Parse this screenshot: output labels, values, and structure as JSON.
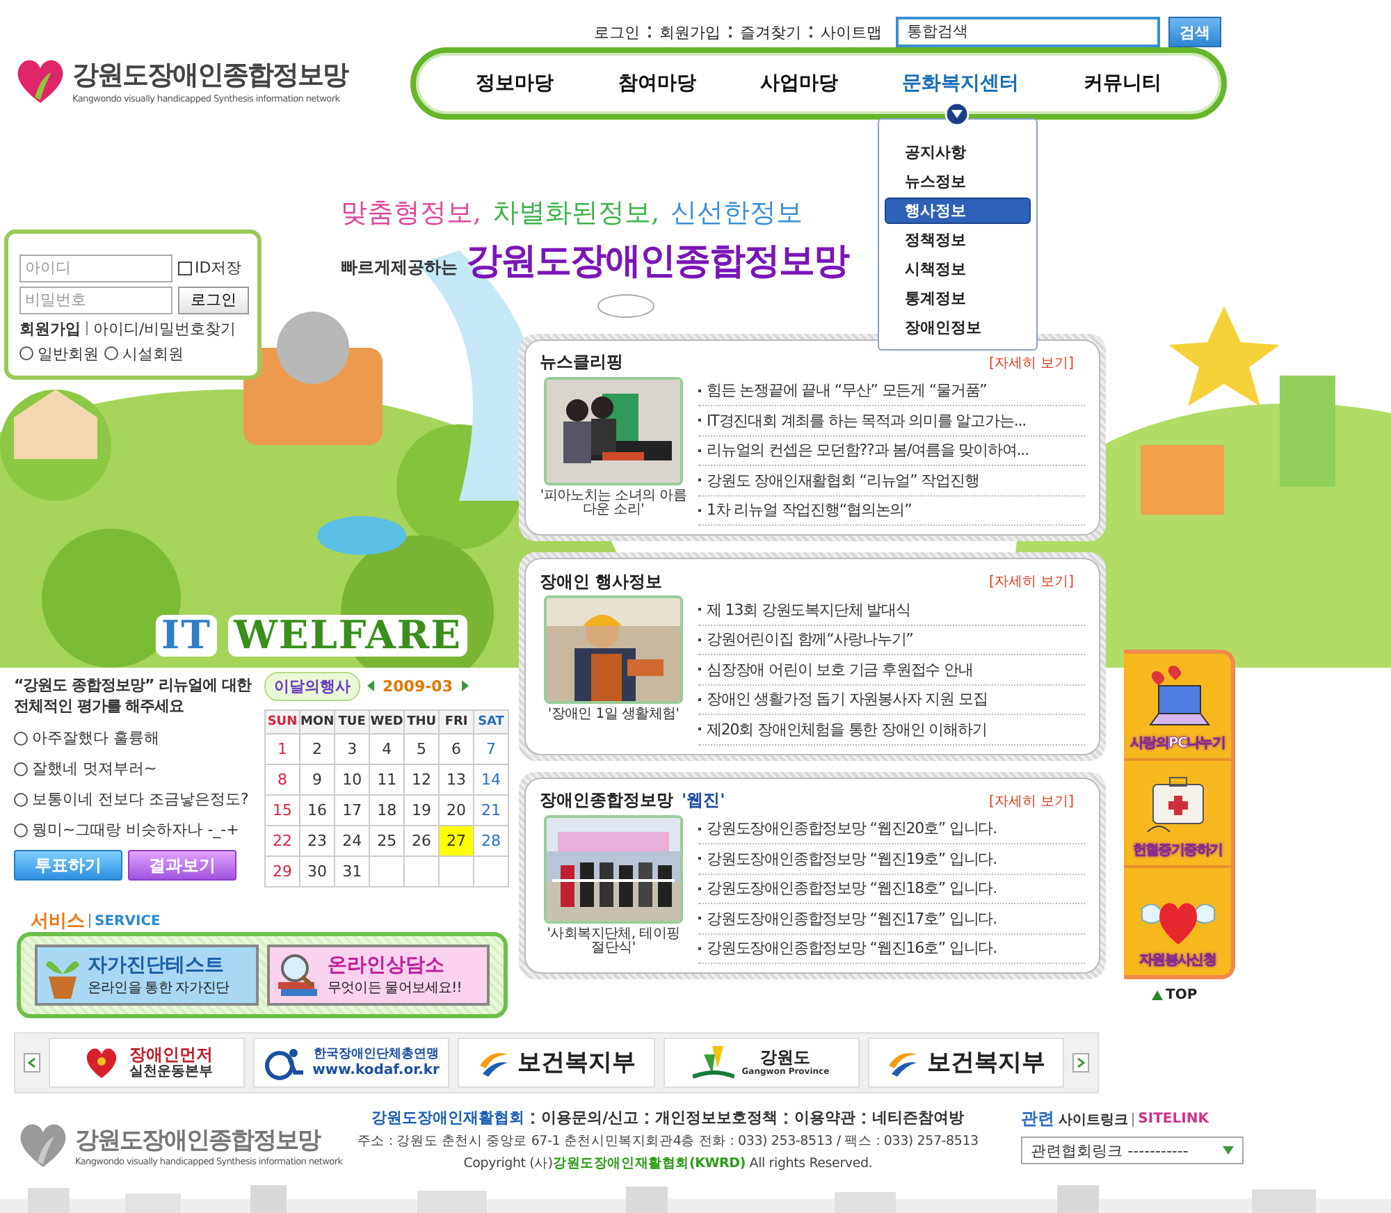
{
  "header": {
    "logo": {
      "title": "강원도장애인종합정보망",
      "subtitle": "Kangwondo visually handicapped Synthesis information network"
    },
    "top_links": [
      "로그인",
      "회원가입",
      "즐겨찾기",
      "사이트맵"
    ],
    "search": {
      "placeholder": "통합검색",
      "button": "검색"
    },
    "nav": [
      {
        "label": "정보마당",
        "selected": false
      },
      {
        "label": "참여마당",
        "selected": false
      },
      {
        "label": "사업마당",
        "selected": false
      },
      {
        "label": "문화복지센터",
        "selected": true,
        "submenu": [
          {
            "label": "공지사항",
            "selected": false
          },
          {
            "label": "뉴스정보",
            "selected": false
          },
          {
            "label": "행사정보",
            "selected": true
          },
          {
            "label": "정책정보",
            "selected": false
          },
          {
            "label": "시책정보",
            "selected": false
          },
          {
            "label": "통계정보",
            "selected": false
          },
          {
            "label": "장애인정보",
            "selected": false
          }
        ]
      },
      {
        "label": "커뮤니티",
        "selected": false
      }
    ]
  },
  "login": {
    "id_placeholder": "아이디",
    "password_placeholder": "비밀번호",
    "remember": {
      "label": "ID저장",
      "checked": false
    },
    "button": "로그인",
    "join": "회원가입",
    "find": "아이디/비밀번호찾기",
    "member_types": [
      {
        "label": "일반회원",
        "selected": false
      },
      {
        "label": "시설회원",
        "selected": false
      }
    ]
  },
  "slogan": {
    "phrases": [
      {
        "text": "맞춤형정보,",
        "color": "#e0469a"
      },
      {
        "text": "차별화된정보,",
        "color": "#3cb34a"
      },
      {
        "text": "신선한정보",
        "color": "#3a8fd6"
      }
    ],
    "lead": "빠르게제공하는",
    "name": "강원도장애인종합정보망"
  },
  "banner_words": [
    {
      "text": "IT",
      "color": "#2f7fc8"
    },
    {
      "text": "WELFARE",
      "color": "#3a8f1c"
    }
  ],
  "poll": {
    "question": "“강원도 종합정보망” 리뉴얼에 대한 전체적인 평가를 해주세요",
    "options": [
      {
        "label": "아주잘했다 훌륭해",
        "selected": false
      },
      {
        "label": "잘했네 멋져부러~",
        "selected": false
      },
      {
        "label": "보통이네 전보다 조금낳은정도?",
        "selected": false
      },
      {
        "label": "뭥미~그때랑 비슷하자나 -_-+",
        "selected": false
      }
    ],
    "vote_button": "투표하기",
    "result_button": "결과보기"
  },
  "calendar": {
    "title": "이달의행사",
    "month": "2009-03",
    "weekdays": [
      "SUN",
      "MON",
      "TUE",
      "WED",
      "THU",
      "FRI",
      "SAT"
    ],
    "weeks": [
      [
        {
          "day": "1",
          "highlighted": false
        },
        {
          "day": "2",
          "highlighted": false
        },
        {
          "day": "3",
          "highlighted": false
        },
        {
          "day": "4",
          "highlighted": false
        },
        {
          "day": "5",
          "highlighted": false
        },
        {
          "day": "6",
          "highlighted": false
        },
        {
          "day": "7",
          "highlighted": false
        }
      ],
      [
        {
          "day": "8",
          "highlighted": false
        },
        {
          "day": "9",
          "highlighted": false
        },
        {
          "day": "10",
          "highlighted": false
        },
        {
          "day": "11",
          "highlighted": false
        },
        {
          "day": "12",
          "highlighted": false
        },
        {
          "day": "13",
          "highlighted": false
        },
        {
          "day": "14",
          "highlighted": false
        }
      ],
      [
        {
          "day": "15",
          "highlighted": false
        },
        {
          "day": "16",
          "highlighted": false
        },
        {
          "day": "17",
          "highlighted": false
        },
        {
          "day": "18",
          "highlighted": false
        },
        {
          "day": "19",
          "highlighted": false
        },
        {
          "day": "20",
          "highlighted": false
        },
        {
          "day": "21",
          "highlighted": false
        }
      ],
      [
        {
          "day": "22",
          "highlighted": false
        },
        {
          "day": "23",
          "highlighted": false
        },
        {
          "day": "24",
          "highlighted": false
        },
        {
          "day": "25",
          "highlighted": false
        },
        {
          "day": "26",
          "highlighted": false
        },
        {
          "day": "27",
          "highlighted": true
        },
        {
          "day": "28",
          "highlighted": false
        }
      ],
      [
        {
          "day": "29",
          "highlighted": false
        },
        {
          "day": "30",
          "highlighted": false
        },
        {
          "day": "31",
          "highlighted": false
        }
      ]
    ]
  },
  "service": {
    "title": "서비스",
    "subtitle": "SERVICE",
    "items": [
      {
        "kind": "test",
        "title": "자가진단테스트",
        "text": "온라인을 통한 자가진단"
      },
      {
        "kind": "counsel",
        "title": "온라인상담소",
        "text": "무엇이든 물어보세요!!"
      }
    ]
  },
  "panels": [
    {
      "title": "뉴스클리핑",
      "more": "[자세히 보기]",
      "caption": "'피아노치는 소녀의 아름다운 소리'",
      "items": [
        "힘든 논쟁끝에 끝내 “무산” 모든게 “물거품”",
        "IT경진대회 계최를 하는 목적과 의미를 알고가는...",
        "리뉴얼의 컨셉은 모던함??과 봄/여름을 맞이하여...",
        "강원도 장애인재활협회 “리뉴얼” 작업진행",
        "1차 리뉴얼 작업진행“협의논의”"
      ]
    },
    {
      "title": "장애인 행사정보",
      "more": "[자세히 보기]",
      "caption": "'장애인 1일 생활체험'",
      "items": [
        "제 13회 강원도복지단체 발대식",
        "강원어린이집 함께“사랑나누기”",
        "심장장애 어린이 보호 기금 후원접수 안내",
        "장애인 생활가정 돕기 자원봉사자 지원 모집",
        "제20회 장애인체험을 통한 장애인 이해하기"
      ]
    },
    {
      "title": "장애인종합정보망",
      "title_suffix": "'웹진'",
      "more": "[자세히 보기]",
      "caption": "'사회복지단체, 테이핑 절단식'",
      "items": [
        "강원도장애인종합정보망 “웹진20호” 입니다.",
        "강원도장애인종합정보망 “웹진19호” 입니다.",
        "강원도장애인종합정보망 “웹진18호” 입니다.",
        "강원도장애인종합정보망 “웹진17호” 입니다.",
        "강원도장애인종합정보망 “웹진16호” 입니다."
      ]
    }
  ],
  "side_menu": [
    {
      "kind": "pc",
      "label": "사랑의PC나누기"
    },
    {
      "kind": "blood",
      "label": "헌혈증기증하기"
    },
    {
      "kind": "volunteer",
      "label": "자원봉사신청"
    }
  ],
  "top_link": "TOP",
  "partners": [
    {
      "kind": "campaign",
      "name": "장애인먼저",
      "sub": "실천운동본부"
    },
    {
      "kind": "kodaf",
      "name": "한국장애인단체총연맹",
      "sub": "www.kodaf.or.kr"
    },
    {
      "kind": "ministry",
      "name": "보건복지부"
    },
    {
      "kind": "province",
      "name": "강원도",
      "sub": "Gangwon Province"
    },
    {
      "kind": "ministry",
      "name": "보건복지부"
    }
  ],
  "footer": {
    "logo": {
      "title": "강원도장애인종합정보망",
      "subtitle": "Kangwondo visually handicapped Synthesis information network"
    },
    "org": "강원도장애인재활협회",
    "links": [
      "이용문의/신고",
      "개인정보보호정책",
      "이용약관",
      "네티즌참여방"
    ],
    "address": "주소 : 강원도 춘천시 중앙로 67-1 춘천시민복지회관4층 전화 : 033) 253-8513 / 팩스 : 033) 257-8513",
    "copyright": "Copyright (사)**강원도장애인재활협회(KWRD)** All rights Reserved.",
    "related": {
      "title": "관련",
      "label": "사이트링크",
      "label_en": "SITELINK",
      "select": "관련협회링크 -----------"
    }
  }
}
